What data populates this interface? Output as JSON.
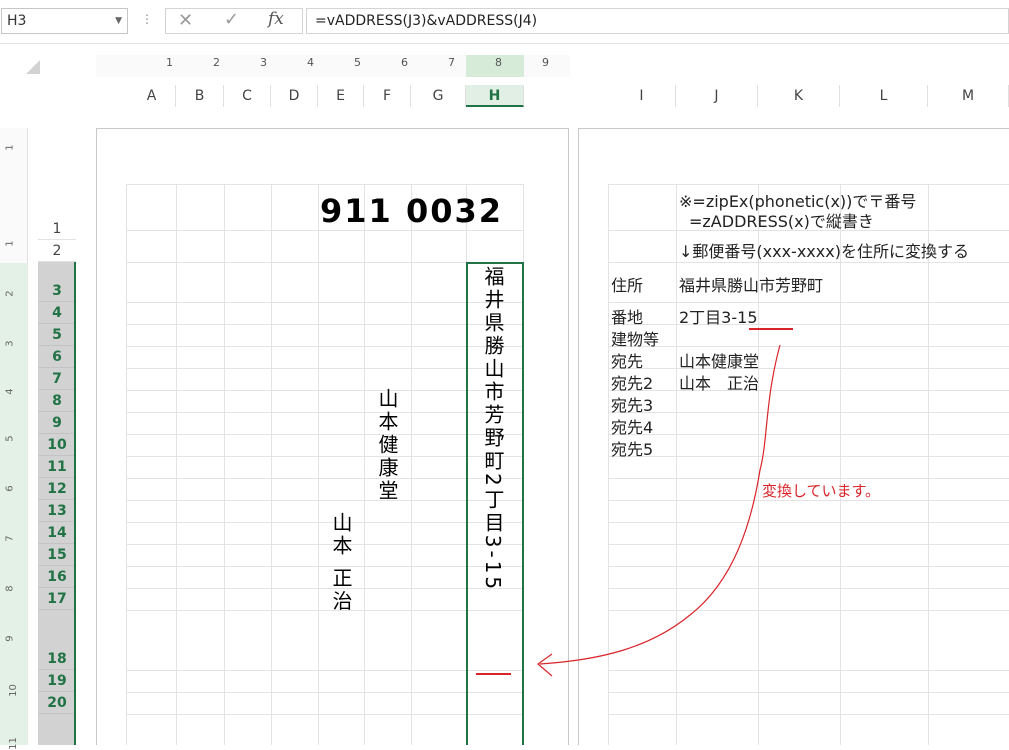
{
  "formula_bar": {
    "name_box": "H3",
    "dots": "⋮",
    "cancel": "✕",
    "enter": "✓",
    "fx": "fx",
    "formula": "=vADDRESS(J3)&vADDRESS(J4)"
  },
  "ruler": {
    "h": [
      "1",
      "2",
      "3",
      "4",
      "5",
      "6",
      "7",
      "8",
      "9"
    ],
    "v": [
      "1",
      "1",
      "2",
      "3",
      "4",
      "5",
      "6",
      "7",
      "8",
      "9",
      "10",
      "11"
    ]
  },
  "columns_left": [
    "A",
    "B",
    "C",
    "D",
    "E",
    "F",
    "G",
    "H"
  ],
  "columns_right": [
    "I",
    "J",
    "K",
    "L",
    "M"
  ],
  "rows": [
    "1",
    "2",
    "3",
    "4",
    "5",
    "6",
    "7",
    "8",
    "9",
    "10",
    "11",
    "12",
    "13",
    "14",
    "15",
    "16",
    "17",
    "18",
    "19",
    "20"
  ],
  "left_page": {
    "zip": "911 0032",
    "address_vertical": "福井県勝山市芳野町2丁目3-15",
    "addressee1_vertical": "山本健康堂",
    "addressee2_vertical": "山本 正治"
  },
  "right_page": {
    "note1": "※=zipEx(phonetic(x))で〒番号",
    "note2": "=zADDRESS(x)で縦書き",
    "note3": "↓郵便番号(xxx-xxxx)を住所に変換する",
    "labels": [
      "住所",
      "番地",
      "建物等",
      "宛先",
      "宛先2",
      "宛先3",
      "宛先4",
      "宛先5"
    ],
    "values": [
      "福井県勝山市芳野町",
      "2丁目3-15",
      "",
      "山本健康堂",
      "山本　正治",
      "",
      "",
      ""
    ],
    "annotation": "変換しています。"
  },
  "colors": {
    "accent": "#217346",
    "annotation": "#d9252a"
  }
}
